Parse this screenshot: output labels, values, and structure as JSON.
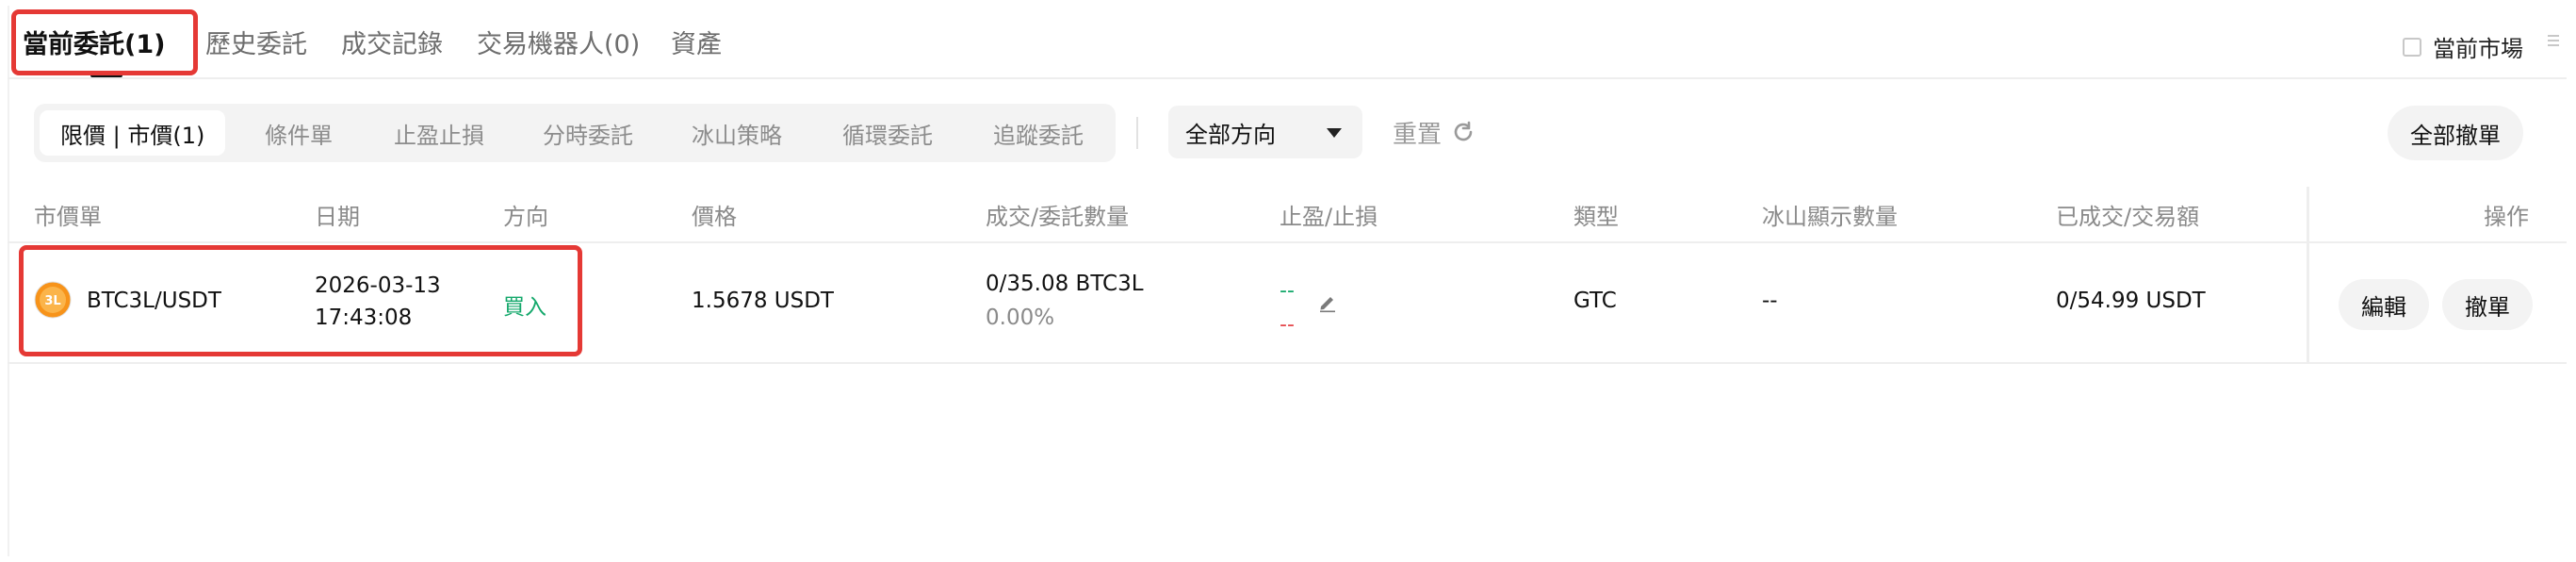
{
  "tabs": [
    {
      "label": "當前委託(1)",
      "active": true
    },
    {
      "label": "歷史委託"
    },
    {
      "label": "成交記錄"
    },
    {
      "label": "交易機器人(0)"
    },
    {
      "label": "資產"
    }
  ],
  "current_market_label": "當前市場",
  "filter_tabs": [
    {
      "label": "限價 | 市價(1)",
      "selected": true
    },
    {
      "label": "條件單"
    },
    {
      "label": "止盈止損"
    },
    {
      "label": "分時委託"
    },
    {
      "label": "冰山策略"
    },
    {
      "label": "循環委託"
    },
    {
      "label": "追蹤委託"
    }
  ],
  "direction_select": {
    "value": "全部方向"
  },
  "reset_label": "重置",
  "cancel_all_label": "全部撤單",
  "columns": [
    "市價單",
    "日期",
    "方向",
    "價格",
    "成交/委託數量",
    "止盈/止損",
    "類型",
    "冰山顯示數量",
    "已成交/交易額",
    "操作"
  ],
  "orders": [
    {
      "pair": "BTC3L/USDT",
      "coin_badge": "3L",
      "date": "2026-03-13",
      "time": "17:43:08",
      "side": "買入",
      "price": "1.5678 USDT",
      "filled_qty": "0/35.08 BTC3L",
      "filled_pct": "0.00%",
      "take_profit": "--",
      "stop_loss": "--",
      "type": "GTC",
      "iceberg_qty": "--",
      "filled_amount": "0/54.99 USDT",
      "edit_label": "編輯",
      "cancel_label": "撤單"
    }
  ],
  "colors": {
    "buy": "#14a86b",
    "sell": "#e5484d",
    "highlight": "#e53935",
    "coin": "#f7931a"
  },
  "icons": [
    "checkbox-icon",
    "menu-icon",
    "caret-down-icon",
    "refresh-icon",
    "coin-icon",
    "edit-pencil-icon"
  ]
}
